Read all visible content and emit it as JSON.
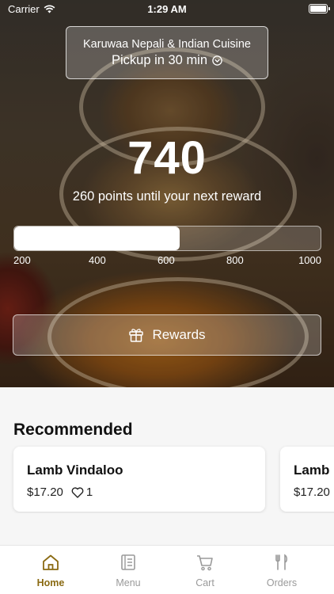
{
  "status_bar": {
    "carrier": "Carrier",
    "time": "1:29 AM"
  },
  "restaurant": {
    "name": "Karuwaa Nepali & Indian Cuisine",
    "pickup": "Pickup in 30 min"
  },
  "rewards": {
    "points": "740",
    "subtitle": "260 points until your next reward",
    "progress_fraction": 0.54,
    "ticks": [
      "200",
      "400",
      "600",
      "800",
      "1000"
    ],
    "button_label": "Rewards"
  },
  "recommended": {
    "title": "Recommended",
    "items": [
      {
        "name": "Lamb Vindaloo",
        "price": "$17.20",
        "likes": "1"
      },
      {
        "name": "Lamb Korma",
        "price": "$17.20",
        "likes": ""
      }
    ]
  },
  "tabs": [
    {
      "label": "Home",
      "icon": "home-icon",
      "active": true
    },
    {
      "label": "Menu",
      "icon": "menu-icon",
      "active": false
    },
    {
      "label": "Cart",
      "icon": "cart-icon",
      "active": false
    },
    {
      "label": "Orders",
      "icon": "fork-knife-icon",
      "active": false
    }
  ],
  "colors": {
    "accent": "#8a6a12",
    "inactive_tab": "#9a9a9a"
  }
}
